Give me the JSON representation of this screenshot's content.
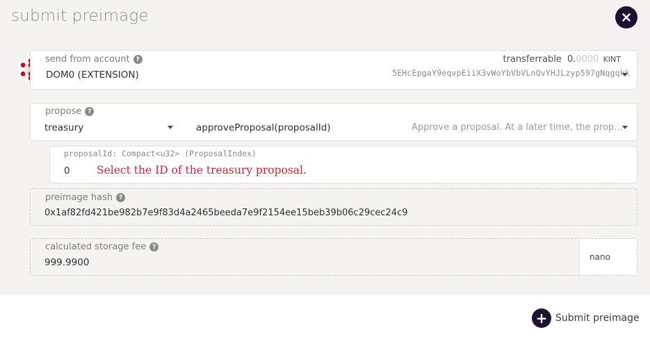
{
  "modal": {
    "title": "submit preimage"
  },
  "account": {
    "label": "send from account",
    "name": "DOM0 (EXTENSION)",
    "address": "5EHcEpgaY9eqvpEiiX3vWoYbVbVLnQvYHJLzyp597gNqgqkk",
    "transferrable_label": "transferrable",
    "balance_integer": "0.",
    "balance_decimals": "0000",
    "balance_unit": "KINT"
  },
  "propose": {
    "label": "propose",
    "section": "treasury",
    "method": "approveProposal(proposalId)",
    "description": "Approve a proposal. At a later time, the prop…"
  },
  "param": {
    "label": "proposalId: Compact<u32> (ProposalIndex)",
    "value": "0",
    "hint": "Select the ID of the treasury proposal."
  },
  "preimage": {
    "label": "preimage hash",
    "value": "0x1af82fd421be982b7e9f83d4a2465beeda7e9f2154ee15beb39b06c29cec24c9"
  },
  "storage_fee": {
    "label": "calculated storage fee",
    "value": "999.9900",
    "unit": "nano"
  },
  "actions": {
    "submit_label": "Submit preimage"
  },
  "colors": {
    "accent_dark": "#1f1132",
    "hint_red": "#d0243b",
    "identicon_red": "#b5141b"
  }
}
